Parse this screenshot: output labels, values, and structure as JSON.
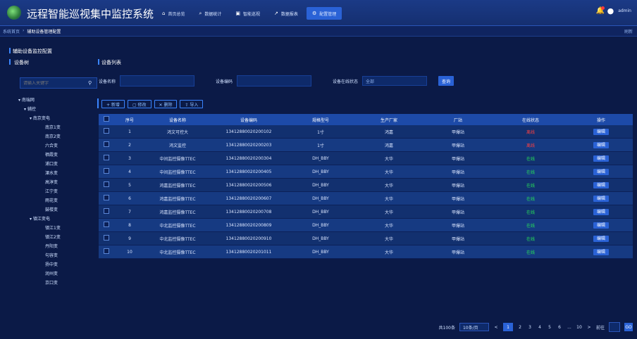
{
  "header": {
    "title": "远程智能巡视集中监控系统",
    "nav": [
      {
        "icon": "home-icon",
        "glyph": "⌂",
        "label": "首页总览",
        "active": false
      },
      {
        "icon": "search-icon",
        "glyph": "⌕",
        "label": "数据统计",
        "active": false
      },
      {
        "icon": "monitor-icon",
        "glyph": "▣",
        "label": "智能巡视",
        "active": false
      },
      {
        "icon": "chart-icon",
        "glyph": "↗",
        "label": "数据报表",
        "active": false
      },
      {
        "icon": "gear-icon",
        "glyph": "⚙",
        "label": "配置管理",
        "active": true
      }
    ],
    "username": "admin"
  },
  "breadcrumb": {
    "items": [
      "系统首页",
      "辅助设备管理配置"
    ],
    "refresh": "刷新"
  },
  "page": {
    "section_title": "辅助设备监控配置"
  },
  "sidebar": {
    "title": "设备树",
    "search_placeholder": "请输入关键字",
    "tree": [
      {
        "label": "▾ 南瑞网",
        "indent": 8
      },
      {
        "label": "▾ 辅控",
        "indent": 16
      },
      {
        "label": "▾ 南京变电",
        "indent": 24
      },
      {
        "label": "南京1变",
        "indent": 46
      },
      {
        "label": "南京2变",
        "indent": 46
      },
      {
        "label": "六合变",
        "indent": 46
      },
      {
        "label": "栖霞变",
        "indent": 46
      },
      {
        "label": "浦口变",
        "indent": 46
      },
      {
        "label": "溧水变",
        "indent": 46
      },
      {
        "label": "高淳变",
        "indent": 46
      },
      {
        "label": "江宁变",
        "indent": 46
      },
      {
        "label": "雨花变",
        "indent": 46
      },
      {
        "label": "鼓楼变",
        "indent": 46
      },
      {
        "label": "▾ 镇江变电",
        "indent": 24
      },
      {
        "label": "镇江1变",
        "indent": 46
      },
      {
        "label": "镇江2变",
        "indent": 46
      },
      {
        "label": "丹阳变",
        "indent": 46
      },
      {
        "label": "句容变",
        "indent": 46
      },
      {
        "label": "扬中变",
        "indent": 46
      },
      {
        "label": "润州变",
        "indent": 46
      },
      {
        "label": "京口变",
        "indent": 46
      }
    ]
  },
  "panel": {
    "title": "设备列表",
    "filters": {
      "name_label": "设备名称",
      "code_label": "设备编码",
      "status_label": "设备在线状态",
      "status_value": "全部",
      "search_button": "查询"
    },
    "actions": [
      "+ 新增",
      "▢ 修改",
      "✕ 删除",
      "⇪ 导入"
    ],
    "columns": [
      "",
      "序号",
      "设备名称",
      "设备编码",
      "规格型号",
      "生产厂家",
      "厂站",
      "在线状态",
      "操作"
    ],
    "rows": [
      {
        "no": "1",
        "name": "鸿文可控大",
        "code": "13412880020200102",
        "model": "1寸",
        "maker": "鸿嘉",
        "station": "甲爆站",
        "status": "离线",
        "status_class": "st-red",
        "op": "编辑"
      },
      {
        "no": "2",
        "name": "鸿文监控",
        "code": "13412880020200203",
        "model": "1寸",
        "maker": "鸿嘉",
        "station": "甲爆站",
        "status": "离线",
        "status_class": "st-red",
        "op": "编辑"
      },
      {
        "no": "3",
        "name": "中间监控摄像TTEC",
        "code": "13412880020200304",
        "model": "DH_BBY",
        "maker": "大华",
        "station": "甲爆站",
        "status": "在线",
        "status_class": "st-green",
        "op": "编辑"
      },
      {
        "no": "4",
        "name": "中间监控摄像TTEC",
        "code": "13412880020200405",
        "model": "DH_BBY",
        "maker": "大华",
        "station": "甲爆站",
        "status": "在线",
        "status_class": "st-green",
        "op": "编辑"
      },
      {
        "no": "5",
        "name": "鸿嘉监控摄像TTEC",
        "code": "13412880020200506",
        "model": "DH_BBY",
        "maker": "大华",
        "station": "甲爆站",
        "status": "在线",
        "status_class": "st-green",
        "op": "编辑"
      },
      {
        "no": "6",
        "name": "鸿嘉监控摄像TTEC",
        "code": "13412880020200607",
        "model": "DH_BBY",
        "maker": "大华",
        "station": "甲爆站",
        "status": "在线",
        "status_class": "st-green",
        "op": "编辑"
      },
      {
        "no": "7",
        "name": "鸿嘉监控摄像TTEC",
        "code": "13412880020200708",
        "model": "DH_BBY",
        "maker": "大华",
        "station": "甲爆站",
        "status": "在线",
        "status_class": "st-green",
        "op": "编辑"
      },
      {
        "no": "8",
        "name": "中北监控摄像TTEC",
        "code": "13412880020200809",
        "model": "DH_BBY",
        "maker": "大华",
        "station": "甲爆站",
        "status": "在线",
        "status_class": "st-green",
        "op": "编辑"
      },
      {
        "no": "9",
        "name": "中北监控摄像TTEC",
        "code": "13412880020200910",
        "model": "DH_BBY",
        "maker": "大华",
        "station": "甲爆站",
        "status": "在线",
        "status_class": "st-green",
        "op": "编辑"
      },
      {
        "no": "10",
        "name": "中北监控摄像TTEC",
        "code": "13412880020201011",
        "model": "DH_BBY",
        "maker": "大华",
        "station": "甲爆站",
        "status": "在线",
        "status_class": "st-green",
        "op": "编辑"
      }
    ],
    "pager": {
      "total": "共100条",
      "page_size": "10条/页",
      "prev": "<",
      "pages": [
        "1",
        "2",
        "3",
        "4",
        "5",
        "6",
        "...",
        "10"
      ],
      "current": "1",
      "next": ">",
      "jump_label": "前往",
      "go": "GO"
    }
  },
  "colors": {
    "background": "#0b1a47",
    "accent": "#2a62d6",
    "online": "#27e05a",
    "offline": "#ff4040"
  }
}
